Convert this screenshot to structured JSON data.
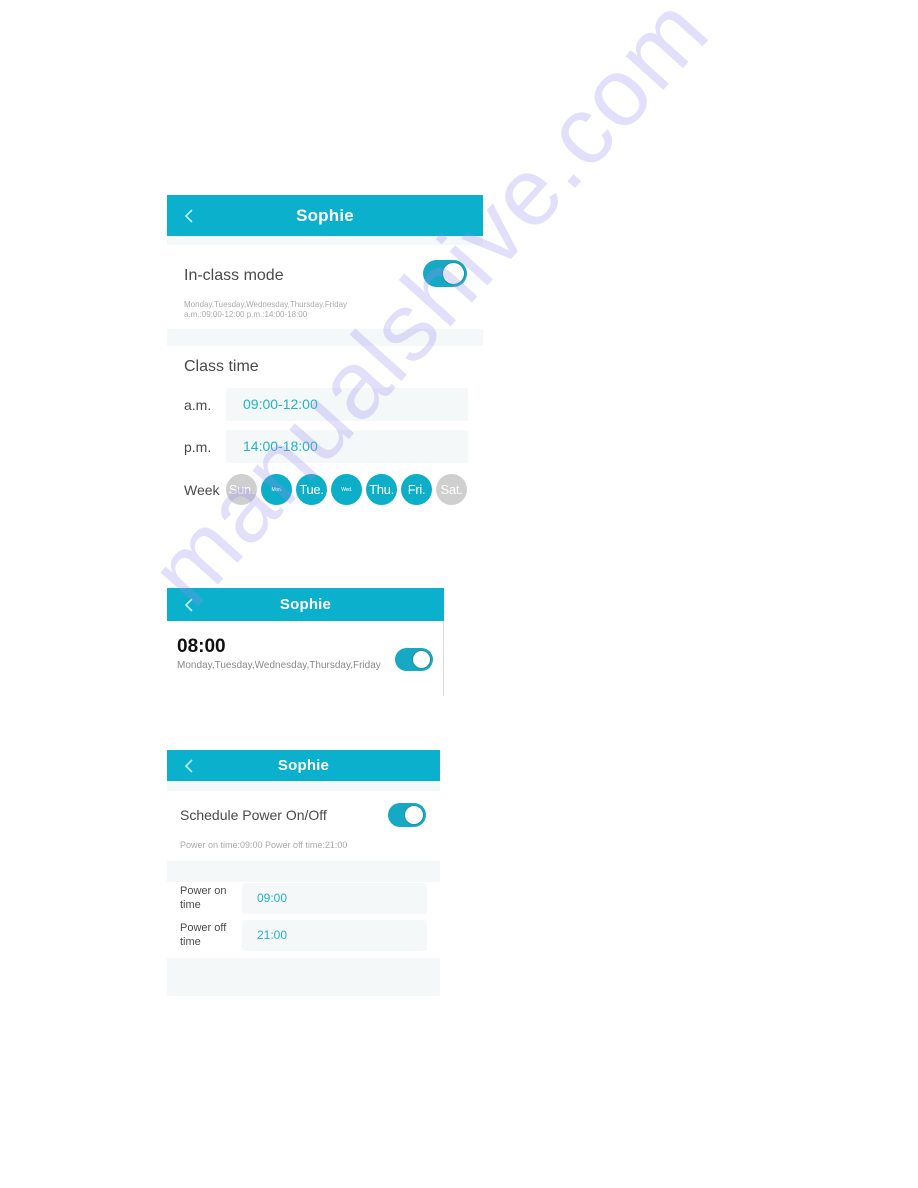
{
  "colors": {
    "header_bg": "#0bb0cc",
    "accent": "#17a9c4",
    "value_text": "#22b3c6",
    "day_off": "#cfcfcf",
    "watermark": "#968cf0"
  },
  "in_class_panel": {
    "header": {
      "back_icon": "chevron-left-icon",
      "title": "Sophie"
    },
    "mode_label": "In-class mode",
    "mode_enabled": true,
    "summary_line1": "Monday,Tuesday,Wednesday,Thursday,Friday",
    "summary_line2": "a.m.:09:00-12:00 p.m.:14:00-18:00",
    "section_title": "Class time",
    "am": {
      "label": "a.m.",
      "value": "09:00-12:00"
    },
    "pm": {
      "label": "p.m.",
      "value": "14:00-18:00"
    },
    "week_label": "Week",
    "days": [
      {
        "label": "Sun.",
        "selected": false
      },
      {
        "label": "Mon.",
        "selected": true
      },
      {
        "label": "Tue.",
        "selected": true
      },
      {
        "label": "Wed.",
        "selected": true
      },
      {
        "label": "Thu.",
        "selected": true
      },
      {
        "label": "Fri.",
        "selected": true
      },
      {
        "label": "Sat.",
        "selected": false
      }
    ]
  },
  "alarm_panel": {
    "header": {
      "back_icon": "chevron-left-icon",
      "title": "Sophie"
    },
    "time": "08:00",
    "days": "Monday,Tuesday,Wednesday,Thursday,Friday",
    "enabled": true
  },
  "power_panel": {
    "header": {
      "back_icon": "chevron-left-icon",
      "title": "Sophie"
    },
    "schedule_label": "Schedule Power On/Off",
    "enabled": true,
    "summary": "Power on time:09:00  Power off time:21:00",
    "power_on": {
      "label": "Power on time",
      "value": "09:00"
    },
    "power_off": {
      "label": "Power off time",
      "value": "21:00"
    }
  },
  "watermark_text": "manualshive.com"
}
